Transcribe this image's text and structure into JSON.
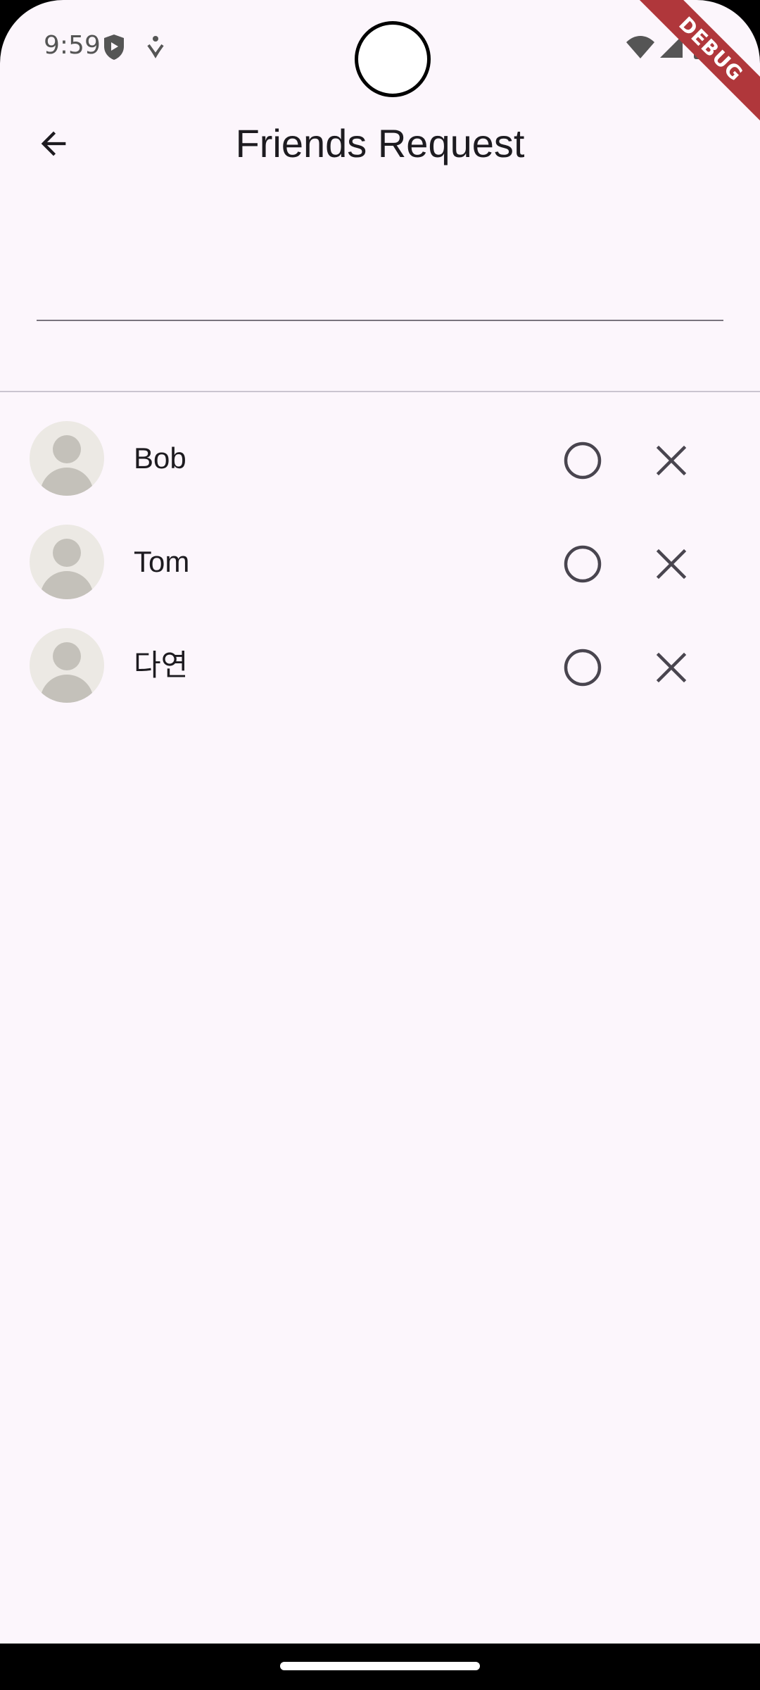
{
  "status_bar": {
    "time": "9:59",
    "debug_label": "DEBUG"
  },
  "app_bar": {
    "title": "Friends Request",
    "back_icon": "arrow-back-icon"
  },
  "search": {
    "value": "",
    "placeholder": ""
  },
  "requests": [
    {
      "name": "Bob",
      "accept_icon": "circle-outline-icon",
      "reject_icon": "close-icon"
    },
    {
      "name": "Tom",
      "accept_icon": "circle-outline-icon",
      "reject_icon": "close-icon"
    },
    {
      "name": "다연",
      "accept_icon": "circle-outline-icon",
      "reject_icon": "close-icon"
    }
  ],
  "colors": {
    "background": "#FCF6FC",
    "text": "#1D1B20",
    "icon": "#49454F",
    "avatar_bg": "#ECE9E4",
    "avatar_fg": "#C4C1BA",
    "debug_banner": "#B0373B"
  }
}
